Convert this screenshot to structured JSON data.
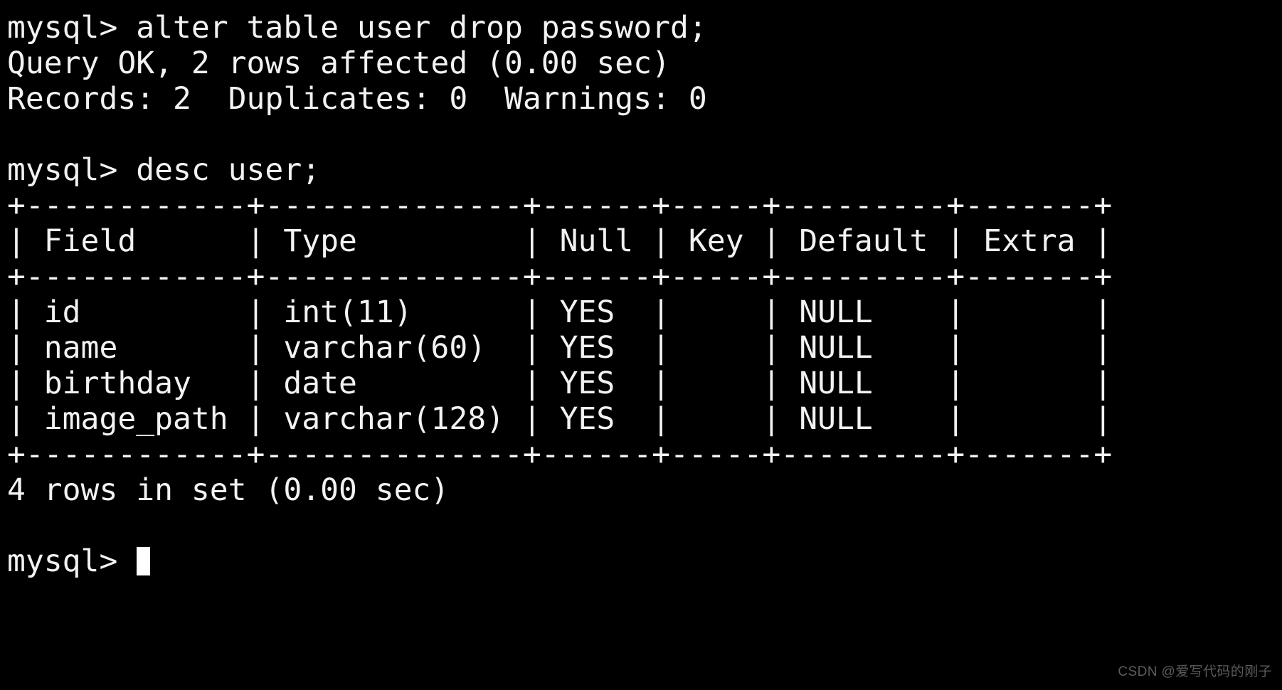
{
  "terminal": {
    "background_color": "#000000",
    "foreground_color": "#f2f2f2",
    "prompt": "mysql>",
    "cursor": {
      "shape": "block",
      "color": "#ffffff"
    },
    "lines": [
      "mysql> alter table user drop password;",
      "Query OK, 2 rows affected (0.00 sec)",
      "Records: 2  Duplicates: 0  Warnings: 0",
      "",
      "mysql> desc user;",
      "+------------+--------------+------+-----+---------+-------+",
      "| Field      | Type         | Null | Key | Default | Extra |",
      "+------------+--------------+------+-----+---------+-------+",
      "| id         | int(11)      | YES  |     | NULL    |       |",
      "| name       | varchar(60)  | YES  |     | NULL    |       |",
      "| birthday   | date         | YES  |     | NULL    |       |",
      "| image_path | varchar(128) | YES  |     | NULL    |       |",
      "+------------+--------------+------+-----+---------+-------+",
      "4 rows in set (0.00 sec)",
      ""
    ],
    "final_prompt": "mysql> "
  },
  "commands": {
    "alter_statement": "alter table user drop password;",
    "describe_statement": "desc user;",
    "alter_result": "Query OK, 2 rows affected (0.00 sec)",
    "alter_records": "Records: 2  Duplicates: 0  Warnings: 0",
    "describe_result": "4 rows in set (0.00 sec)"
  },
  "result_table": {
    "columns": [
      "Field",
      "Type",
      "Null",
      "Key",
      "Default",
      "Extra"
    ],
    "rows": [
      [
        "id",
        "int(11)",
        "YES",
        "",
        "NULL",
        ""
      ],
      [
        "name",
        "varchar(60)",
        "YES",
        "",
        "NULL",
        ""
      ],
      [
        "birthday",
        "date",
        "YES",
        "",
        "NULL",
        ""
      ],
      [
        "image_path",
        "varchar(128)",
        "YES",
        "",
        "NULL",
        ""
      ]
    ],
    "row_count": "4"
  },
  "watermark": {
    "text": "CSDN @爱写代码的刚子",
    "color": "#5c5c5c"
  }
}
